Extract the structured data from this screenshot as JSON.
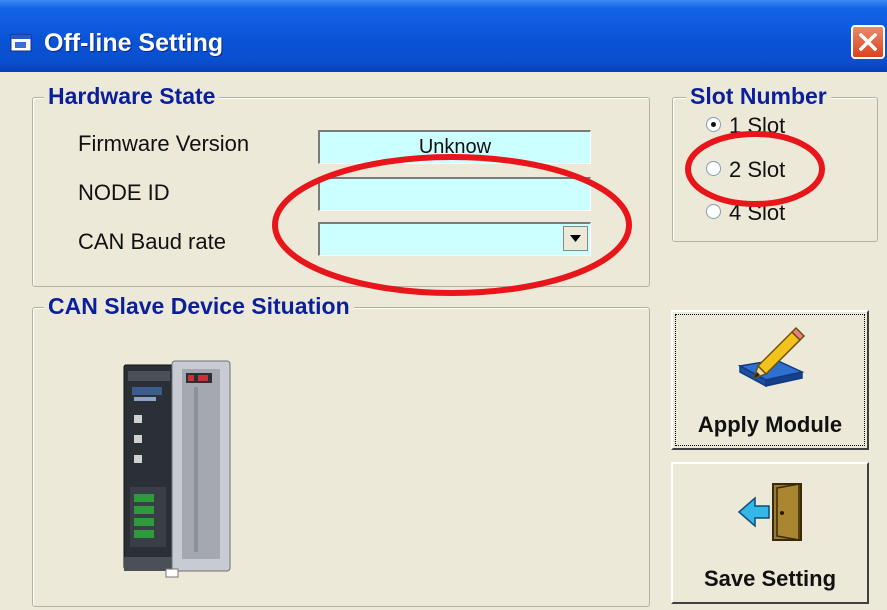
{
  "window": {
    "title": "Off-line Setting",
    "titlebar_color": "#0a53d6",
    "close_icon": "close-icon"
  },
  "hardware_state": {
    "legend": "Hardware State",
    "firmware_label": "Firmware Version",
    "firmware_value": "Unknow",
    "node_id_label": "NODE ID",
    "node_id_value": "",
    "baud_label": "CAN Baud rate",
    "baud_value": "",
    "field_color": "#ccffff"
  },
  "slot_number": {
    "legend": "Slot Number",
    "options": [
      {
        "label": "1 Slot",
        "selected": true
      },
      {
        "label": "2 Slot",
        "selected": false
      },
      {
        "label": "4 Slot",
        "selected": false
      }
    ]
  },
  "slave_device": {
    "legend": "CAN Slave Device Situation",
    "image": "can-slave-device-image"
  },
  "buttons": {
    "apply_label": "Apply Module",
    "apply_icon": "pencil-icon",
    "save_label": "Save Setting",
    "save_icon": "exit-door-icon"
  },
  "annotations": {
    "highlight_color": "#e8151b"
  }
}
